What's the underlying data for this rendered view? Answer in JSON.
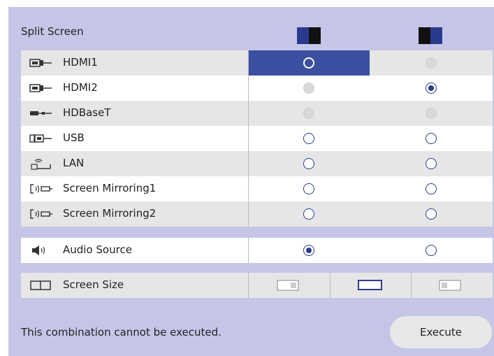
{
  "title": "Split Screen",
  "rows": [
    {
      "label": "HDMI1",
      "icon": "hdmi-icon"
    },
    {
      "label": "HDMI2",
      "icon": "hdmi-icon"
    },
    {
      "label": "HDBaseT",
      "icon": "hdbaset-icon"
    },
    {
      "label": "USB",
      "icon": "usb-icon"
    },
    {
      "label": "LAN",
      "icon": "lan-icon"
    },
    {
      "label": "Screen Mirroring1",
      "icon": "screen-mirroring-icon"
    },
    {
      "label": "Screen Mirroring2",
      "icon": "screen-mirroring-icon"
    }
  ],
  "audio": {
    "label": "Audio Source",
    "icon": "speaker-icon"
  },
  "screen_size": {
    "label": "Screen Size",
    "icon": "screen-size-icon"
  },
  "status_message": "This combination cannot be executed.",
  "execute_label": "Execute",
  "colors": {
    "background": "#c5c6e7",
    "accent": "#3b4fa0",
    "radio": "#2b3a8c"
  },
  "selection": {
    "left_screen_source": "HDMI1",
    "right_screen_source": "HDMI2",
    "audio_source": "left"
  }
}
